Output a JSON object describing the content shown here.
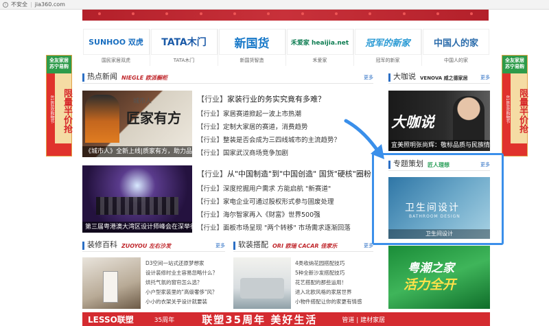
{
  "browser": {
    "security": "不安全",
    "url": "jia360.com"
  },
  "brands": [
    {
      "logo": "SUNHOO 双虎",
      "caption": "国民家居双虎",
      "color": "#1a6fc0"
    },
    {
      "logo": "TATA木门",
      "caption": "TATA木门",
      "color": "#1c5ba8"
    },
    {
      "logo": "新国货",
      "caption": "新国货智造",
      "color": "#1778c8"
    },
    {
      "logo": "禾爱家 heaijia.net",
      "caption": "禾爱家",
      "color": "#0e7d52"
    },
    {
      "logo": "冠军的新家",
      "caption": "冠军的新家",
      "color": "#2a9ad4"
    },
    {
      "logo": "中国人的家",
      "caption": "中国人的家",
      "color": "#2b6cab"
    }
  ],
  "side_ads": {
    "left": {
      "head": "全友家居 苏宁易购",
      "strip": "818狂欢购物节",
      "big": "限量半价抢"
    },
    "right": {
      "head": "全友家居 苏宁易购",
      "strip": "818狂欢购物节",
      "big": "限量半价抢"
    }
  },
  "hot_news": {
    "title": "热点新闻",
    "sponsor": "NIEGLE 欧派橱柜",
    "more": "更多",
    "photo1": {
      "caption": "《城市人》全新上线|质家有方，助力品质人",
      "overlay_title": "匠家有方",
      "overlay_sub": "城市人"
    },
    "group1": [
      {
        "tag": "【行业】",
        "text": "家装行业的务实究竟有多难？"
      },
      {
        "tag": "【行业】",
        "text": "家居赛道掀起一波上市热潮"
      },
      {
        "tag": "【行业】",
        "text": "定制大家居的赛道，消费趋势"
      },
      {
        "tag": "【行业】",
        "text": "整装是否会成为三四线城市的主流趋势？"
      },
      {
        "tag": "【行业】",
        "text": "国家武汉商场竞争加剧"
      }
    ],
    "photo2": {
      "caption": "第三届粤港澳大湾区设计师峰会在深举行"
    },
    "group2": [
      {
        "tag": "【行业】",
        "text": "从\"中国制造\"到\"中国创造\" 国货\"硬核\"圈粉"
      },
      {
        "tag": "【行业】",
        "text": "深度挖掘用户需求 方能启航 \"新赛道\""
      },
      {
        "tag": "【行业】",
        "text": "家电企业可通过股权形式参与固废处理"
      },
      {
        "tag": "【行业】",
        "text": "海尔智家再入《财富》世界500强"
      },
      {
        "tag": "【行业】",
        "text": "面板市场呈现 \"两个转移\" 市场需求逐渐回落"
      }
    ]
  },
  "decor": {
    "title": "装修百科",
    "sponsor": "ZUOYOU 左右沙发",
    "more": "更多",
    "items": [
      "D3空间一站式还原梦想家",
      "设计装修时业主容易忽略什么？",
      "烘托气氛的窗帘怎么选？",
      "小户型家装里的\"高级奢侈\"风？",
      "小小的衣架关乎设计就要装"
    ]
  },
  "soft": {
    "title": "软装搭配",
    "sponsor": "ORI 欧瑞 CACAR 佳家乐",
    "more": "更多",
    "items": [
      "4类收纳花园搭配技巧",
      "5种全新沙发搭配技巧",
      "花艺搭配的那些运用！",
      "进入北欧风格的家居世界",
      "小物件搭配让你的家更有情感"
    ]
  },
  "talk": {
    "title": "大咖说",
    "sponsor": "VENOVA 威之德家居",
    "more": "更多",
    "overlay": "大咖说",
    "caption": "宜美照明张尚辉：敬标品质与民族情怀"
  },
  "special": {
    "title": "专题策划",
    "sponsor": "匠人理想",
    "more": "更多",
    "overlay": "卫生间设计",
    "overlay_sub": "BATHROOM DESIGN",
    "caption": "卫生间设计"
  },
  "guangdong": {
    "line1": "粤潮之家",
    "line2": "活力全开"
  },
  "bottom_banner": {
    "b1": "LESSO联塑",
    "b2": "35周年",
    "b3": "联塑35周年 美好生活",
    "b4": "管道 | 建材家居"
  }
}
